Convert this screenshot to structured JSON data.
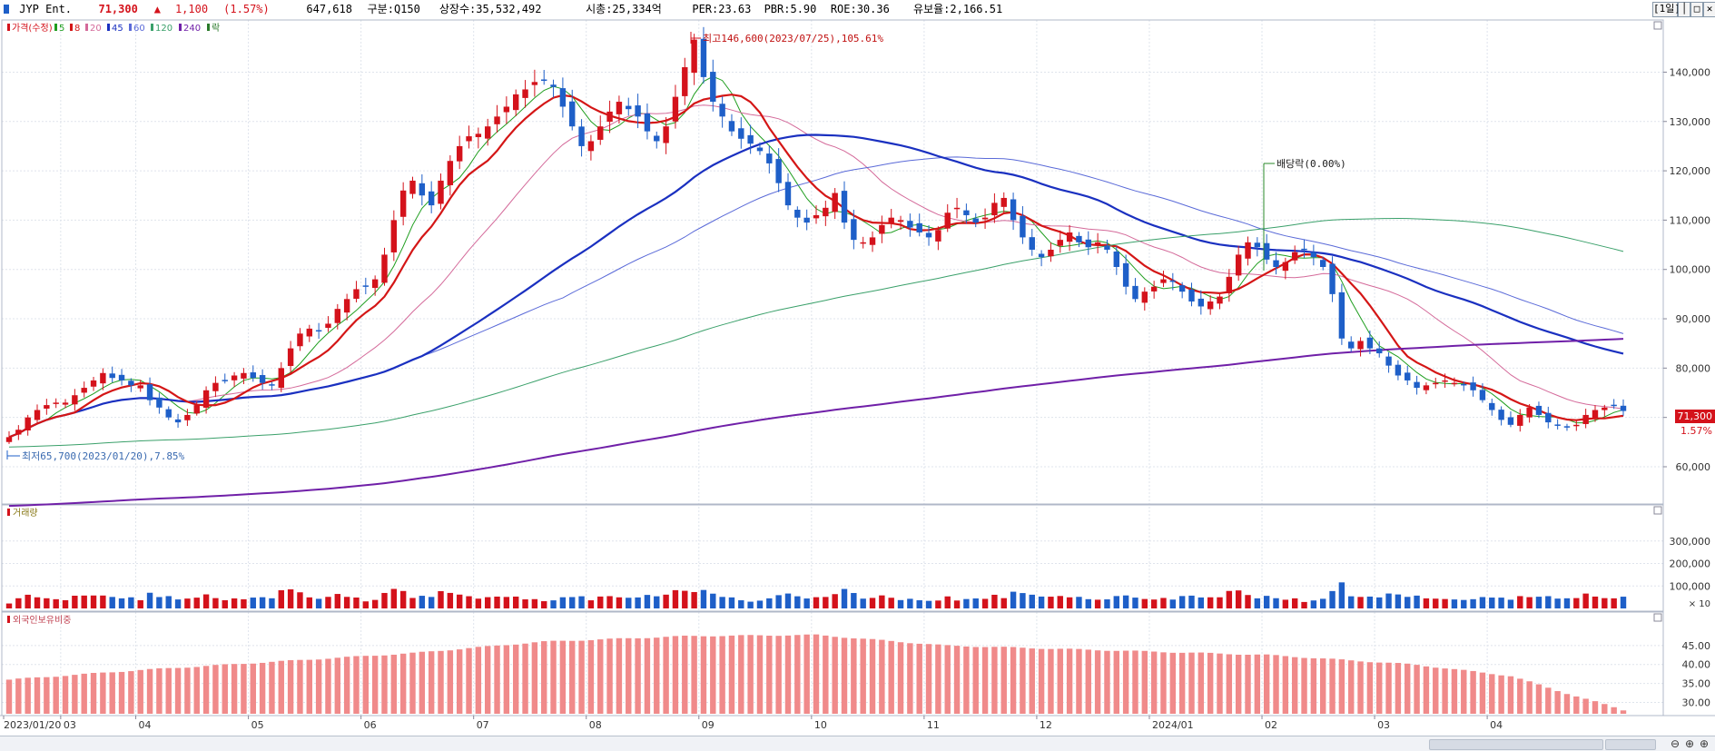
{
  "header": {
    "stock_name": "JYP Ent.",
    "price": "71,300",
    "change_arrow": "▲",
    "change": "1,100",
    "change_pct": "(1.57%)",
    "volume": "647,618",
    "category": "구분:Q150",
    "shares": "상장수:35,532,492",
    "market_cap": "시총:25,334억",
    "per": "PER:23.63",
    "pbr": "PBR:5.90",
    "roe": "ROE:30.36",
    "reserve": "유보율:2,166.51",
    "period_button": "[1일]",
    "window_buttons": [
      "│",
      "□",
      "✕"
    ]
  },
  "colors": {
    "up": "#d4121b",
    "down": "#1e5fc8",
    "ma5": "#1f9e1f",
    "ma8": "#d41616",
    "ma20": "#d46a9a",
    "ma45": "#1a30c0",
    "ma60": "#5a6ad8",
    "ma120": "#3aa06a",
    "ma240": "#7020a8",
    "foreign": "#f08a8a"
  },
  "legend": {
    "price_items": [
      {
        "label": "가격(수정)",
        "color": "#d4121b"
      },
      {
        "label": "5",
        "color": "#1f9e1f"
      },
      {
        "label": "8",
        "color": "#d41616"
      },
      {
        "label": "20",
        "color": "#d46a9a"
      },
      {
        "label": "45",
        "color": "#1a30c0"
      },
      {
        "label": "60",
        "color": "#5a6ad8"
      },
      {
        "label": "120",
        "color": "#3aa06a"
      },
      {
        "label": "240",
        "color": "#7020a8"
      },
      {
        "label": "락",
        "color": "#2a7a2a"
      }
    ],
    "volume_label": "거래량",
    "foreign_label": "외국인보유비중"
  },
  "chart_data": {
    "type": "candlestick",
    "price_axis": {
      "ticks": [
        "140,000",
        "130,000",
        "120,000",
        "110,000",
        "100,000",
        "90,000",
        "80,000",
        "70,000",
        "60,000"
      ],
      "values": [
        140000,
        130000,
        120000,
        110000,
        100000,
        90000,
        80000,
        70000,
        60000
      ],
      "range": [
        53000,
        148000
      ]
    },
    "volume_axis": {
      "ticks": [
        "300,000",
        "200,000",
        "100,000"
      ],
      "values": [
        300000,
        200000,
        100000
      ],
      "unit": "× 10",
      "range": [
        0,
        380000
      ]
    },
    "foreign_axis": {
      "ticks": [
        "45.00",
        "40.00",
        "35.00",
        "30.00"
      ],
      "values": [
        45,
        40,
        35,
        30
      ],
      "range": [
        27,
        50
      ]
    },
    "x_axis": {
      "labels": [
        "2023/01/20",
        "03",
        "04",
        "05",
        "06",
        "07",
        "08",
        "09",
        "10",
        "11",
        "12",
        "2024/01",
        "02",
        "03",
        "04"
      ]
    },
    "price_series": [
      {
        "month": "2023/01",
        "values": [
          66000,
          67500,
          70000,
          71500,
          72500,
          73000
        ]
      },
      {
        "month": "02",
        "values": [
          73000,
          74500,
          76000,
          77500,
          79000,
          78000,
          77500,
          76500
        ]
      },
      {
        "month": "03",
        "values": [
          76500,
          73500,
          72000,
          70000,
          69000,
          70500,
          72500,
          75500,
          77000,
          77500,
          78500,
          79000
        ]
      },
      {
        "month": "04",
        "values": [
          78000,
          77000,
          76500,
          80000,
          84000,
          87000,
          88000,
          87500,
          89000,
          92000,
          94000,
          96000
        ]
      },
      {
        "month": "05",
        "values": [
          96500,
          98000,
          103000,
          110000,
          116000,
          118000,
          115000,
          113000,
          118000,
          122000,
          125000,
          127000
        ]
      },
      {
        "month": "06",
        "values": [
          127500,
          129000,
          131000,
          133000,
          135500,
          136500,
          138000,
          138500,
          137000,
          133000,
          129000,
          125000
        ]
      },
      {
        "month": "07",
        "values": [
          126000,
          129000,
          132000,
          134000,
          132500,
          131000,
          128000,
          126000,
          129000,
          135000,
          141000,
          146600
        ]
      },
      {
        "month": "08",
        "values": [
          139000,
          134000,
          131000,
          128000,
          126500,
          125500,
          124000,
          121500,
          117500,
          113000,
          110500,
          109500
        ]
      },
      {
        "month": "09",
        "values": [
          111000,
          112500,
          115500,
          109500,
          106000,
          105500,
          106500,
          109000,
          110500,
          110000,
          108500,
          107500
        ]
      },
      {
        "month": "10",
        "values": [
          106500,
          108000,
          111500,
          112500,
          111000,
          109500,
          110500,
          113500,
          114500,
          110000,
          106500,
          104000
        ]
      },
      {
        "month": "11",
        "values": [
          102500,
          104000,
          106000,
          107500,
          105500,
          104500,
          105500,
          104000,
          100500,
          96500,
          94000,
          95500
        ]
      },
      {
        "month": "12",
        "values": [
          96500,
          98000,
          97500,
          95500,
          93500,
          92500,
          93500,
          94500,
          98500,
          103000,
          105500,
          104500
        ]
      },
      {
        "month": "2024/01",
        "values": [
          102000,
          100500,
          101500,
          103500,
          104000,
          102500,
          100500,
          95000,
          86000,
          84000,
          85500,
          84000
        ]
      },
      {
        "month": "02",
        "values": [
          83000,
          80500,
          78500,
          77500,
          76000,
          76500,
          77000,
          77500,
          77000,
          76500,
          75500,
          73500
        ]
      },
      {
        "month": "03",
        "values": [
          71500,
          69500,
          68500,
          70500,
          72000,
          70500,
          69000,
          68500,
          68000,
          68500,
          70500,
          71500
        ]
      },
      {
        "month": "04",
        "values": [
          72000,
          72500,
          71300
        ]
      }
    ],
    "annotations": {
      "high": "최고146,600(2023/07/25),105.61%",
      "low": "최저65,700(2023/01/20),7.85%",
      "dividend": "배당락(0.00%)",
      "last_price": "71,300",
      "last_pct": "1.57%"
    }
  }
}
